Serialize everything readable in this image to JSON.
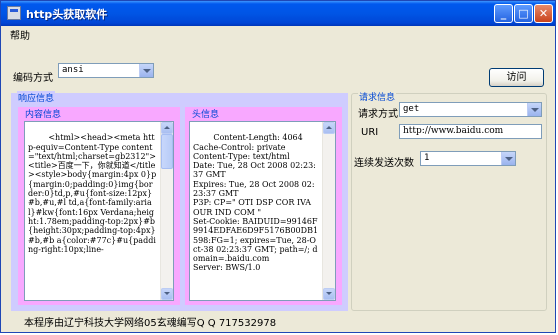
{
  "window": {
    "title": "http头获取软件",
    "controls": [
      "minimize-icon",
      "maximize-icon",
      "close-icon"
    ]
  },
  "menu": {
    "help": "帮助"
  },
  "encoding": {
    "label": "编码方式",
    "value": "ansi"
  },
  "visit_button": "访问",
  "response_group": {
    "title": "响应信息",
    "content_title": "内容信息",
    "content_text": "<html><head><meta http-equiv=Content-Type content=\"text/html;charset=gb2312\"><title>百度一下，你就知道</title><style>body{margin:4px 0}p{margin:0;padding:0}img{border:0}td,p,#u{font-size:12px}#b,#u,#l td,a{font-family:arial}#kw{font:16px Verdana;height:1.78em;padding-top:2px}#b{height:30px;padding-top:4px}#b,#b a{color:#77c}#u{padding-right:10px;line-",
    "header_title": "头信息",
    "header_text": "Content-Length: 4064\nCache-Control: private\nContent-Type: text/html\nDate: Tue, 28 Oct 2008 02:23:37 GMT\nExpires: Tue, 28 Oct 2008 02:23:37 GMT\nP3P: CP=\" OTI DSP COR IVA OUR IND COM \"\nSet-Cookie: BAIDUID=99146F9914EDFAE6D9F5176B00DB1598:FG=1; expires=Tue, 28-Oct-38 02:23:37 GMT; path=/; domain=.baidu.com\nServer: BWS/1.0"
  },
  "request_group": {
    "title": "请求信息",
    "method_label": "请求方式",
    "method_value": "get",
    "uri_label": "URI",
    "uri_value": "http://www.baidu.com",
    "count_label": "连续发送次数",
    "count_value": "1"
  },
  "footer": "本程序由辽宁科技大学网络05玄魂编写Q Q 717532978",
  "colors": {
    "titlebar": "#0055e5",
    "window_bg": "#ece9d8",
    "response_group_bg": "#cfccff",
    "response_subgroup_bg": "#f8a8ff",
    "group_title": "#0046d5"
  }
}
